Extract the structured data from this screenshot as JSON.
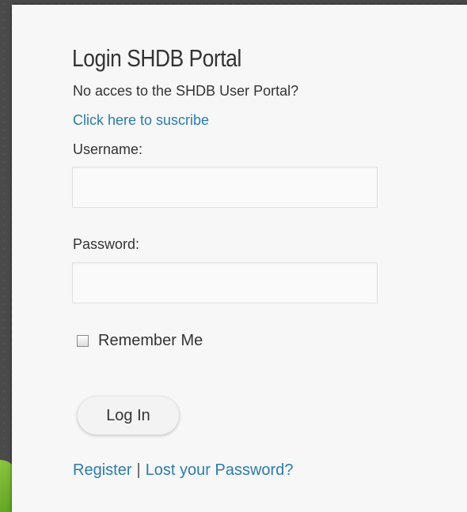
{
  "login": {
    "title": "Login SHDB Portal",
    "no_access_text": "No acces to the SHDB User Portal?",
    "subscribe_link": "Click here to suscribe",
    "username_label": "Username:",
    "username_value": "",
    "password_label": "Password:",
    "password_value": "",
    "remember_label": "Remember Me",
    "remember_checked": false,
    "login_button": "Log In",
    "register_link": "Register",
    "separator": "|",
    "lost_password_link": "Lost your Password?"
  },
  "colors": {
    "link": "#2a7cac",
    "panel_bg": "#f7f7f7",
    "page_bg": "#4a4a4a",
    "accent_green": "#8cc63f"
  }
}
